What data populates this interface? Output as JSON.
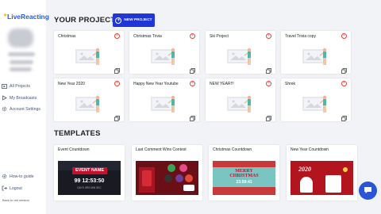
{
  "app": {
    "logo_text": "LiveReacting",
    "logo_star": "✦"
  },
  "sidebar": {
    "nav": [
      {
        "label": "All Projects",
        "icon": "video-icon"
      },
      {
        "label": "My Broadcasts",
        "icon": "play-icon"
      },
      {
        "label": "Account Settings",
        "icon": "gear-icon"
      }
    ],
    "bottom": [
      {
        "label": "How-to guide",
        "icon": "gear-icon"
      },
      {
        "label": "Logout",
        "icon": "logout-icon"
      }
    ],
    "footer_note": "Back to old version"
  },
  "projects": {
    "heading": "YOUR PROJECTS",
    "new_button": "NEW PROJECT",
    "items": [
      {
        "title": "Christmas"
      },
      {
        "title": "Christmas Trivia"
      },
      {
        "title": "Ski Project"
      },
      {
        "title": "Travel Trivia copy"
      },
      {
        "title": "New Year 2020"
      },
      {
        "title": "Happy New Year Youtube"
      },
      {
        "title": "NEW YEAR!!!"
      },
      {
        "title": "Shrek"
      }
    ]
  },
  "templates": {
    "heading": "TEMPLATES",
    "items": [
      {
        "title": "Event Countdown",
        "art_text": "EVENT NAME",
        "art_sub": "99 12:53:50",
        "art_label": "DAYS HRS MIN SEC"
      },
      {
        "title": "Last Comment Wins Contest",
        "art_text": "",
        "art_sub": "",
        "art_label": ""
      },
      {
        "title": "Christmas Countdown",
        "art_text": "MERRY CHRISTMAS",
        "art_sub": "23:59:41",
        "art_label": ""
      },
      {
        "title": "New Year Countdown",
        "art_text": "2020",
        "art_sub": "",
        "art_label": ""
      }
    ]
  },
  "colors": {
    "accent": "#2136d6",
    "delete": "#e0463a",
    "chat": "#2a55d6"
  }
}
